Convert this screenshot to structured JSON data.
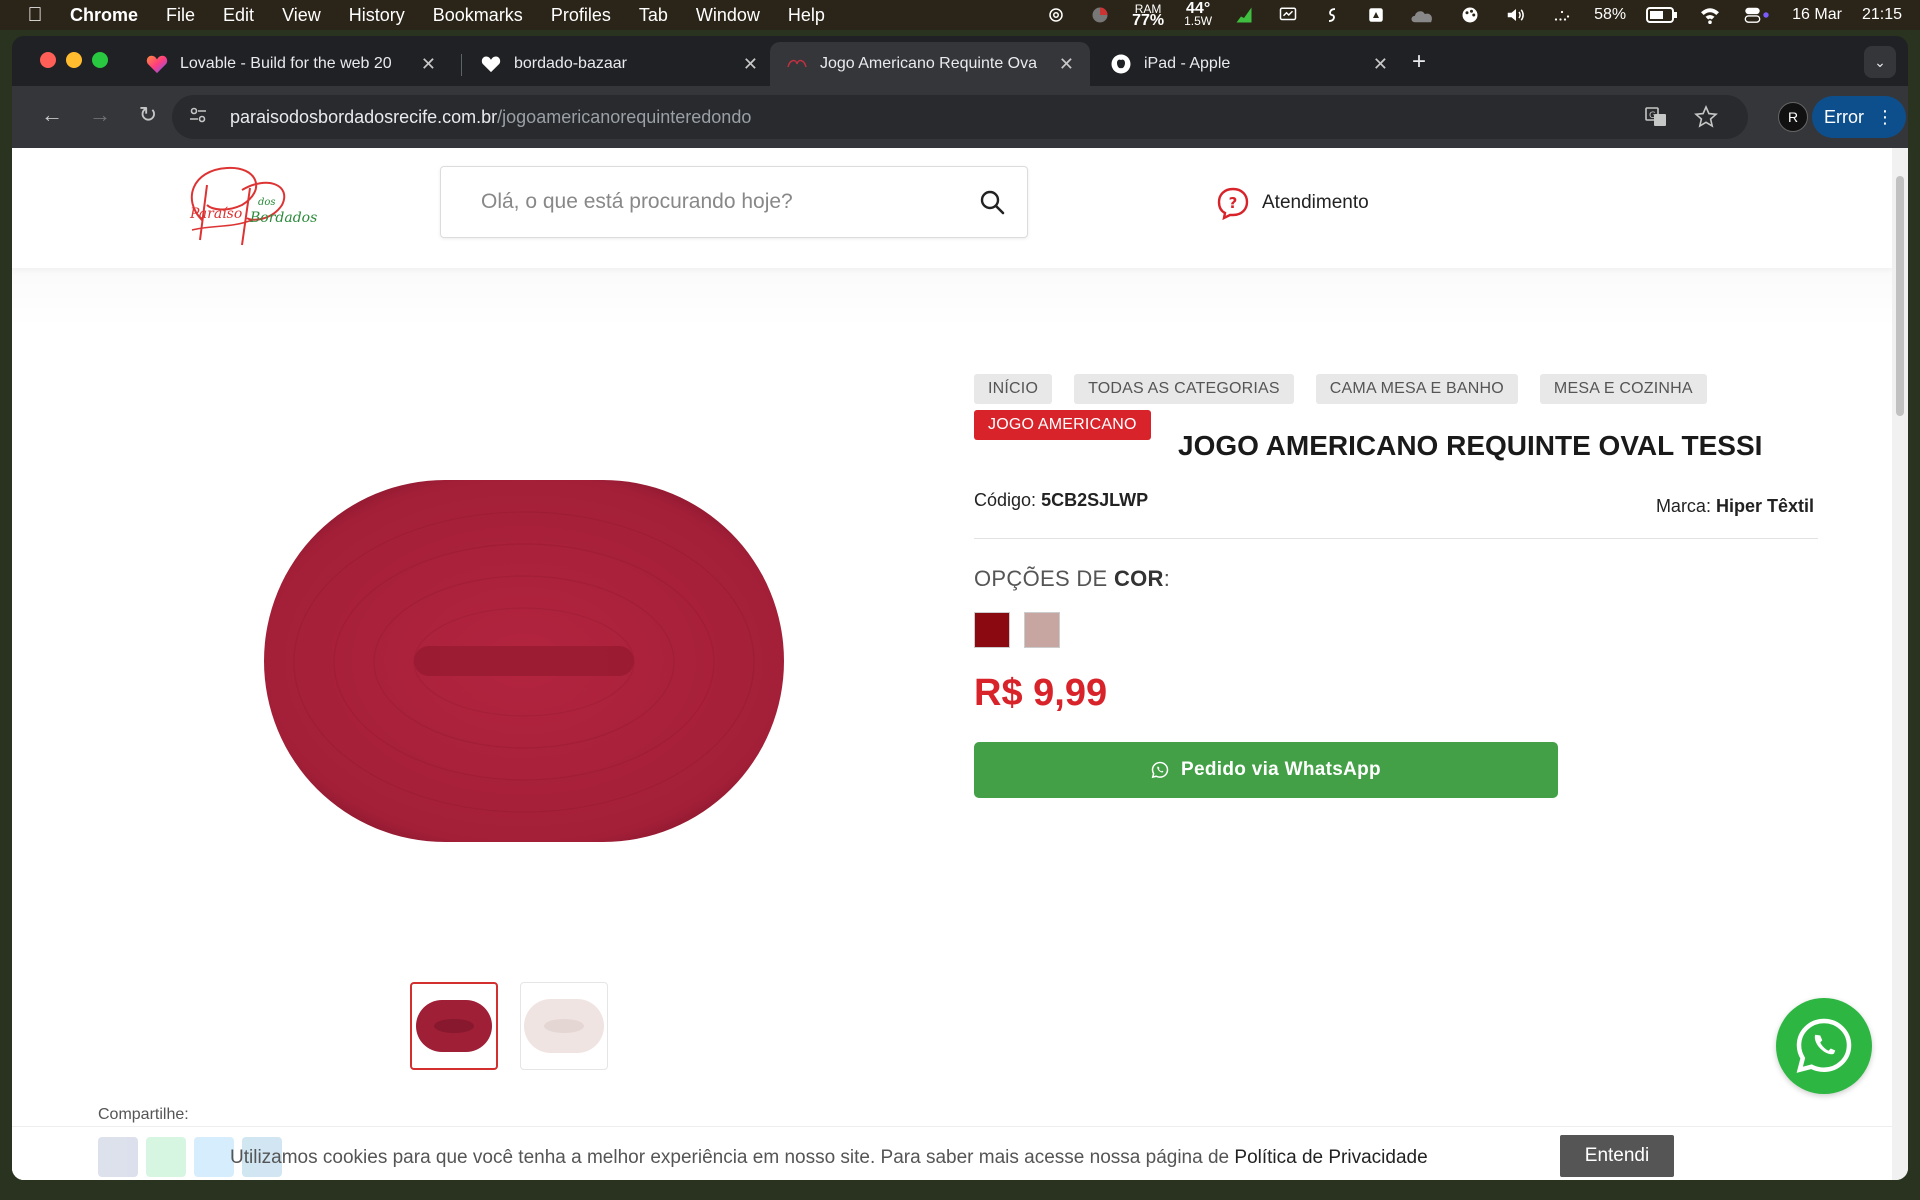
{
  "menubar": {
    "app_name": "Chrome",
    "items": [
      "File",
      "Edit",
      "View",
      "History",
      "Bookmarks",
      "Profiles",
      "Tab",
      "Window",
      "Help"
    ],
    "ram_label": "RAM",
    "ram_value": "77%",
    "temp_value": "44°",
    "power_value": "1.5W",
    "battery_value": "58%",
    "date": "16 Mar",
    "time": "21:15"
  },
  "tabs": [
    {
      "title": "Lovable - Build for the web 20",
      "icon": "heart-gradient-icon"
    },
    {
      "title": "bordado-bazaar",
      "icon": "heart-icon"
    },
    {
      "title": "Jogo Americano Requinte Ova",
      "icon": "site-favicon"
    },
    {
      "title": "iPad - Apple",
      "icon": "apple-icon"
    }
  ],
  "address": {
    "host": "paraisodosbordadosrecife.com.br",
    "path": "/jogoamericanorequinteredondo"
  },
  "toolbar": {
    "error_label": "Error"
  },
  "header": {
    "search_placeholder": "Olá, o que está procurando hoje?",
    "support_label": "Atendimento"
  },
  "breadcrumbs": [
    "INÍCIO",
    "TODAS AS CATEGORIAS",
    "CAMA MESA E BANHO",
    "MESA E COZINHA"
  ],
  "category_tag": "JOGO AMERICANO",
  "product": {
    "title": "JOGO AMERICANO REQUINTE OVAL TESSI",
    "code_label": "Código:",
    "code": "5CB2SJLWP",
    "brand_label": "Marca:",
    "brand": "Hiper Têxtil",
    "options_prefix": "OPÇÕES DE",
    "options_key": "COR",
    "options_suffix": ":",
    "color_options": [
      "#8b0a12",
      "#c7a6a2"
    ],
    "price": "R$ 9,99",
    "whatsapp_button": "Pedido via WhatsApp",
    "mat_colors": {
      "main": "#a8213a",
      "alt": "#efe4e2"
    }
  },
  "share": {
    "label": "Compartilhe:"
  },
  "cookie": {
    "text": "Utilizamos cookies para que você tenha a melhor experiência em nosso site. Para saber mais acesse nossa página de",
    "link": "Política de Privacidade",
    "button": "Entendi"
  },
  "colors": {
    "brand_red": "#d8232a",
    "whatsapp_green": "#43a047"
  }
}
